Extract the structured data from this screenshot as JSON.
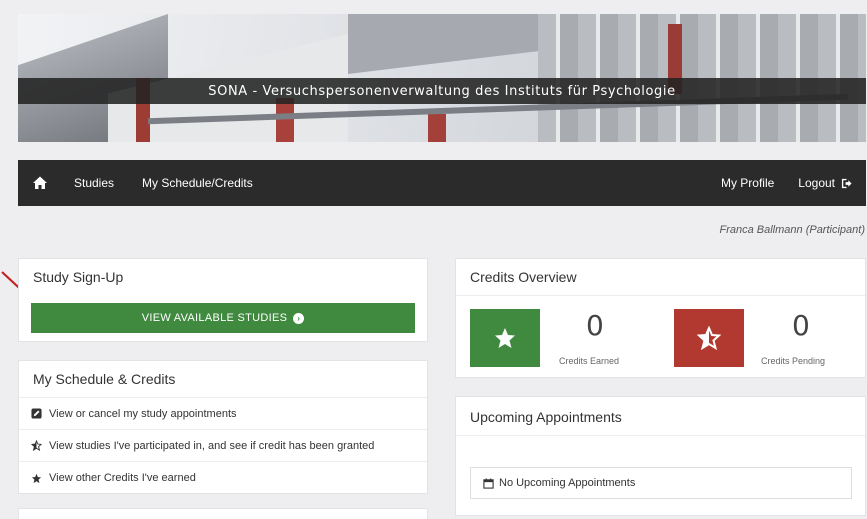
{
  "banner": {
    "title": "SONA - Versuchspersonenverwaltung des Instituts für Psychologie"
  },
  "navbar": {
    "home_icon": "home-icon",
    "studies": "Studies",
    "schedule": "My Schedule/Credits",
    "profile": "My Profile",
    "logout": "Logout",
    "logout_icon": "sign-out-icon"
  },
  "user": {
    "name": "Franca Ballmann (Participant)"
  },
  "signup": {
    "title": "Study Sign-Up",
    "button": "VIEW AVAILABLE STUDIES",
    "button_icon": "chevron-circle-right-icon",
    "button_color": "#3f8a3f"
  },
  "schedule": {
    "title": "My Schedule & Credits",
    "items": [
      {
        "label": "View or cancel my study appointments",
        "icon": "edit-icon"
      },
      {
        "label": "View studies I've participated in, and see if credit has been granted",
        "icon": "star-half-icon"
      },
      {
        "label": "View other Credits I've earned",
        "icon": "star-icon"
      }
    ]
  },
  "credits": {
    "title": "Credits Overview",
    "earned": {
      "value": "0",
      "label": "Credits Earned",
      "color": "#3f8a3f"
    },
    "pending": {
      "value": "0",
      "label": "Credits Pending",
      "color": "#b2392f"
    }
  },
  "upcoming": {
    "title": "Upcoming Appointments",
    "empty": "No Upcoming Appointments",
    "empty_icon": "calendar-icon"
  },
  "annotation": {
    "arrow_color": "#c0221f"
  }
}
